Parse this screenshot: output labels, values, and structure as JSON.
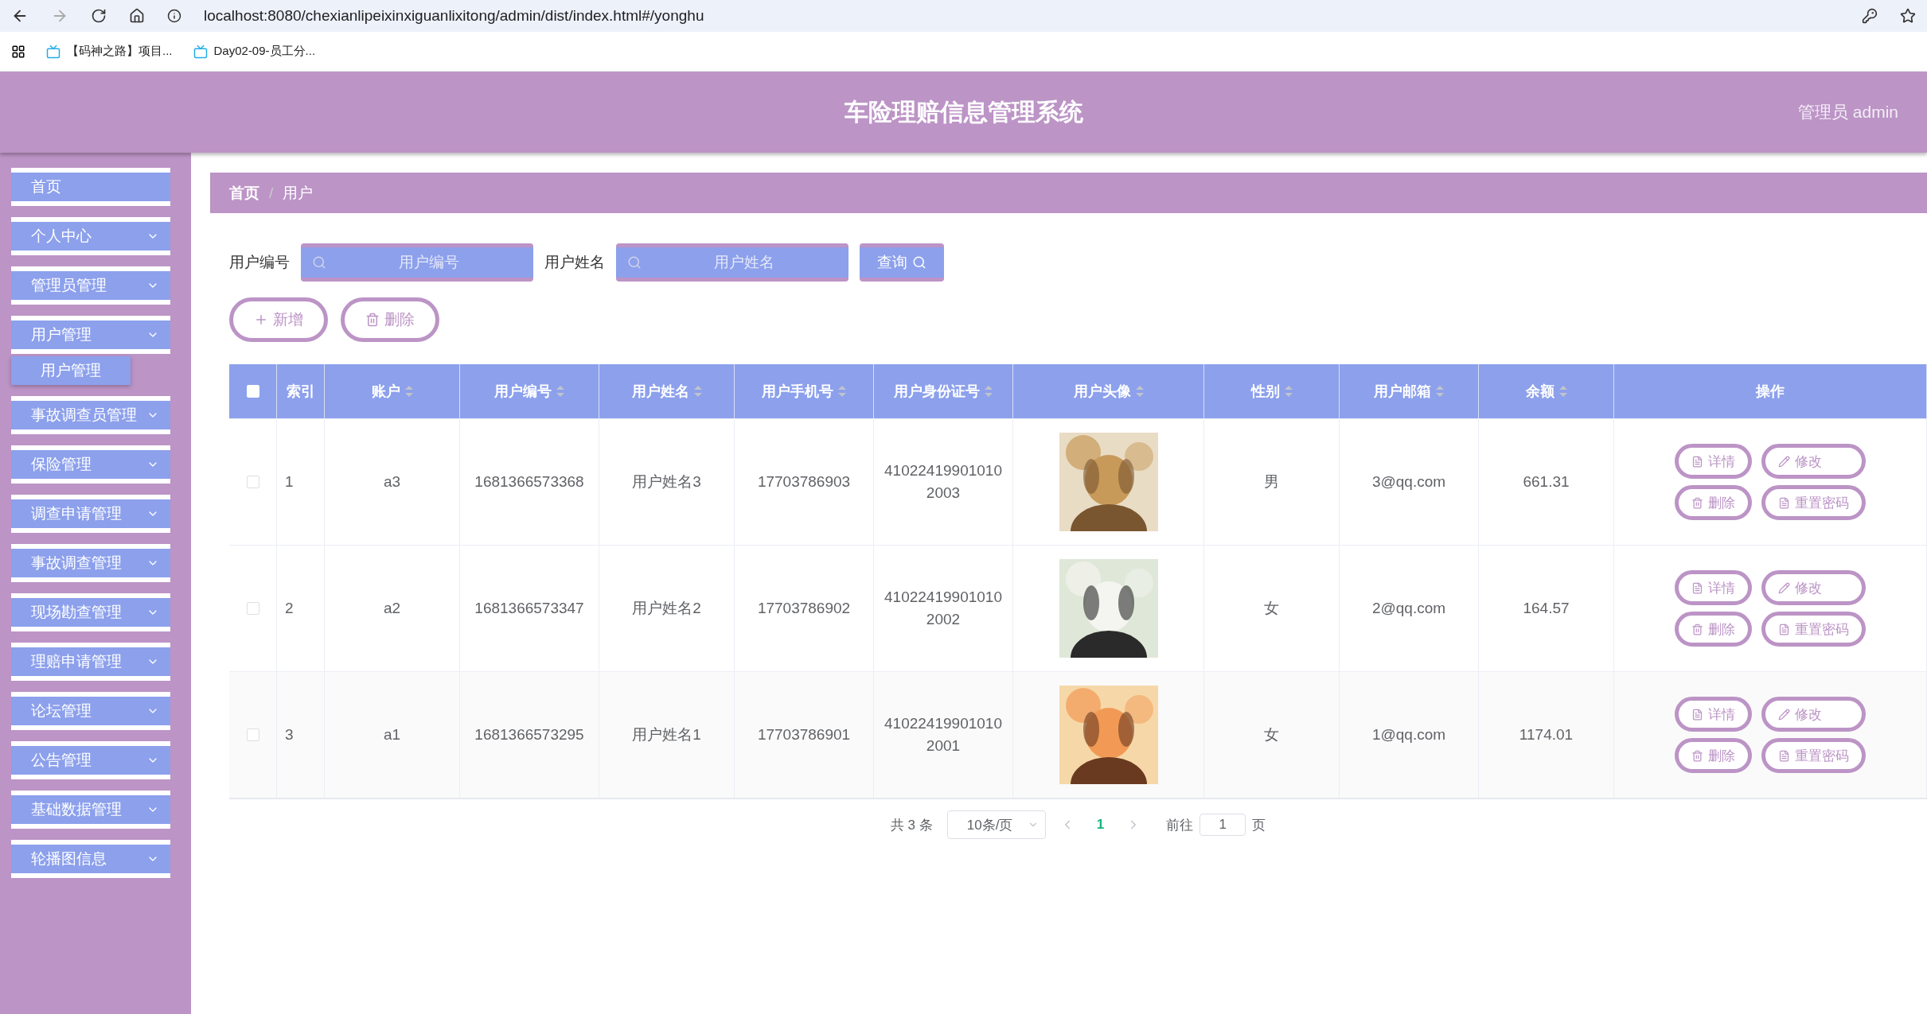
{
  "browser": {
    "url": "localhost:8080/chexianlipeixinxiguanlixitong/admin/dist/index.html#/yonghu",
    "bookmarks": [
      "【码神之路】项目...",
      "Day02-09-员工分..."
    ]
  },
  "header": {
    "title": "车险理赔信息管理系统",
    "user": "管理员 admin"
  },
  "sidebar": {
    "items": [
      {
        "label": "首页",
        "expandable": false
      },
      {
        "label": "个人中心",
        "expandable": true
      },
      {
        "label": "管理员管理",
        "expandable": true
      },
      {
        "label": "用户管理",
        "expandable": true,
        "children": [
          {
            "label": "用户管理"
          }
        ]
      },
      {
        "label": "事故调查员管理",
        "expandable": true
      },
      {
        "label": "保险管理",
        "expandable": true
      },
      {
        "label": "调查申请管理",
        "expandable": true
      },
      {
        "label": "事故调查管理",
        "expandable": true
      },
      {
        "label": "现场勘查管理",
        "expandable": true
      },
      {
        "label": "理赔申请管理",
        "expandable": true
      },
      {
        "label": "论坛管理",
        "expandable": true
      },
      {
        "label": "公告管理",
        "expandable": true
      },
      {
        "label": "基础数据管理",
        "expandable": true
      },
      {
        "label": "轮播图信息",
        "expandable": true
      }
    ]
  },
  "breadcrumb": {
    "items": [
      "首页",
      "用户"
    ],
    "separator": "/"
  },
  "search": {
    "fields": [
      {
        "label": "用户编号",
        "placeholder": "用户编号"
      },
      {
        "label": "用户姓名",
        "placeholder": "用户姓名"
      }
    ],
    "button": "查询"
  },
  "actions": [
    {
      "kind": "add",
      "label": "新增"
    },
    {
      "kind": "delete",
      "label": "删除"
    }
  ],
  "table": {
    "select_all": {
      "checked": false
    },
    "columns": [
      {
        "label": "索引",
        "sortable": false
      },
      {
        "label": "账户",
        "sortable": true
      },
      {
        "label": "用户编号",
        "sortable": true
      },
      {
        "label": "用户姓名",
        "sortable": true
      },
      {
        "label": "用户手机号",
        "sortable": true
      },
      {
        "label": "用户身份证号",
        "sortable": true
      },
      {
        "label": "用户头像",
        "sortable": true
      },
      {
        "label": "性别",
        "sortable": true
      },
      {
        "label": "用户邮箱",
        "sortable": true
      },
      {
        "label": "余额",
        "sortable": true
      },
      {
        "label": "操作",
        "sortable": false
      }
    ],
    "rows": [
      {
        "selected": false,
        "cells": [
          "1",
          "a3",
          "1681366573368",
          "用户姓名3",
          "17703786903",
          "410224199010102003",
          {
            "kind": "picture"
          },
          "男",
          "3@qq.com",
          "661.31"
        ],
        "actions": [
          {
            "kind": "detail",
            "label": "详情"
          },
          {
            "kind": "edit",
            "label": "修改"
          },
          {
            "kind": "delete",
            "label": "删除"
          },
          {
            "kind": "reset",
            "label": "重置密码"
          }
        ]
      },
      {
        "selected": false,
        "cells": [
          "2",
          "a2",
          "1681366573347",
          "用户姓名2",
          "17703786902",
          "410224199010102002",
          {
            "kind": "picture"
          },
          "女",
          "2@qq.com",
          "164.57"
        ],
        "actions": [
          {
            "kind": "detail",
            "label": "详情"
          },
          {
            "kind": "edit",
            "label": "修改"
          },
          {
            "kind": "delete",
            "label": "删除"
          },
          {
            "kind": "reset",
            "label": "重置密码"
          }
        ]
      },
      {
        "selected": false,
        "cells": [
          "3",
          "a1",
          "1681366573295",
          "用户姓名1",
          "17703786901",
          "410224199010102001",
          {
            "kind": "picture"
          },
          "女",
          "1@qq.com",
          "1174.01"
        ],
        "actions": [
          {
            "kind": "detail",
            "label": "详情"
          },
          {
            "kind": "edit",
            "label": "修改"
          },
          {
            "kind": "delete",
            "label": "删除"
          },
          {
            "kind": "reset",
            "label": "重置密码"
          }
        ]
      }
    ]
  },
  "pagination": {
    "total": "共 3 条",
    "page_size": "10条/页",
    "pages": [
      {
        "label": "1",
        "selected": true
      }
    ],
    "goto_label": "前往",
    "goto_value": "1",
    "goto_suffix": "页"
  }
}
